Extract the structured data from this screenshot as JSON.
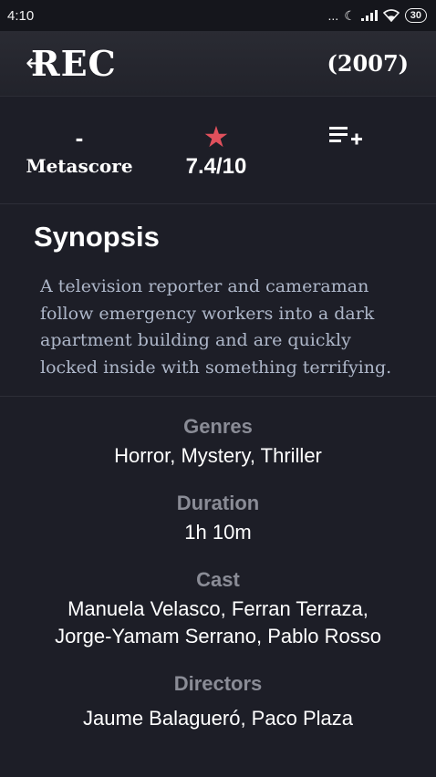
{
  "status_bar": {
    "time": "4:10",
    "dots": "...",
    "battery": "30"
  },
  "header": {
    "back_icon": "back-arrow-icon",
    "title": "REC",
    "year": "(2007)"
  },
  "ratings": {
    "metascore_value": "-",
    "metascore_label": "Metascore",
    "imdb_icon": "star-icon",
    "imdb_value": "7.4/10",
    "list_icon": "playlist-add-icon"
  },
  "synopsis": {
    "title": "Synopsis",
    "text": "A television reporter and cameraman follow emergency workers into a dark apartment building and are quickly locked inside with something terrifying."
  },
  "details": {
    "genres_label": "Genres",
    "genres_value": "Horror, Mystery, Thriller",
    "duration_label": "Duration",
    "duration_value": "1h 10m",
    "cast_label": "Cast",
    "cast_value": "Manuela Velasco, Ferran Terraza, Jorge-Yamam Serrano, Pablo Rosso",
    "directors_label": "Directors",
    "directors_value": "Jaume Balagueró, Paco Plaza"
  },
  "colors": {
    "background": "#1d1e27",
    "star": "#e0505c",
    "synopsis_text": "#aeb7c9",
    "label_gray": "#8a8c96"
  }
}
